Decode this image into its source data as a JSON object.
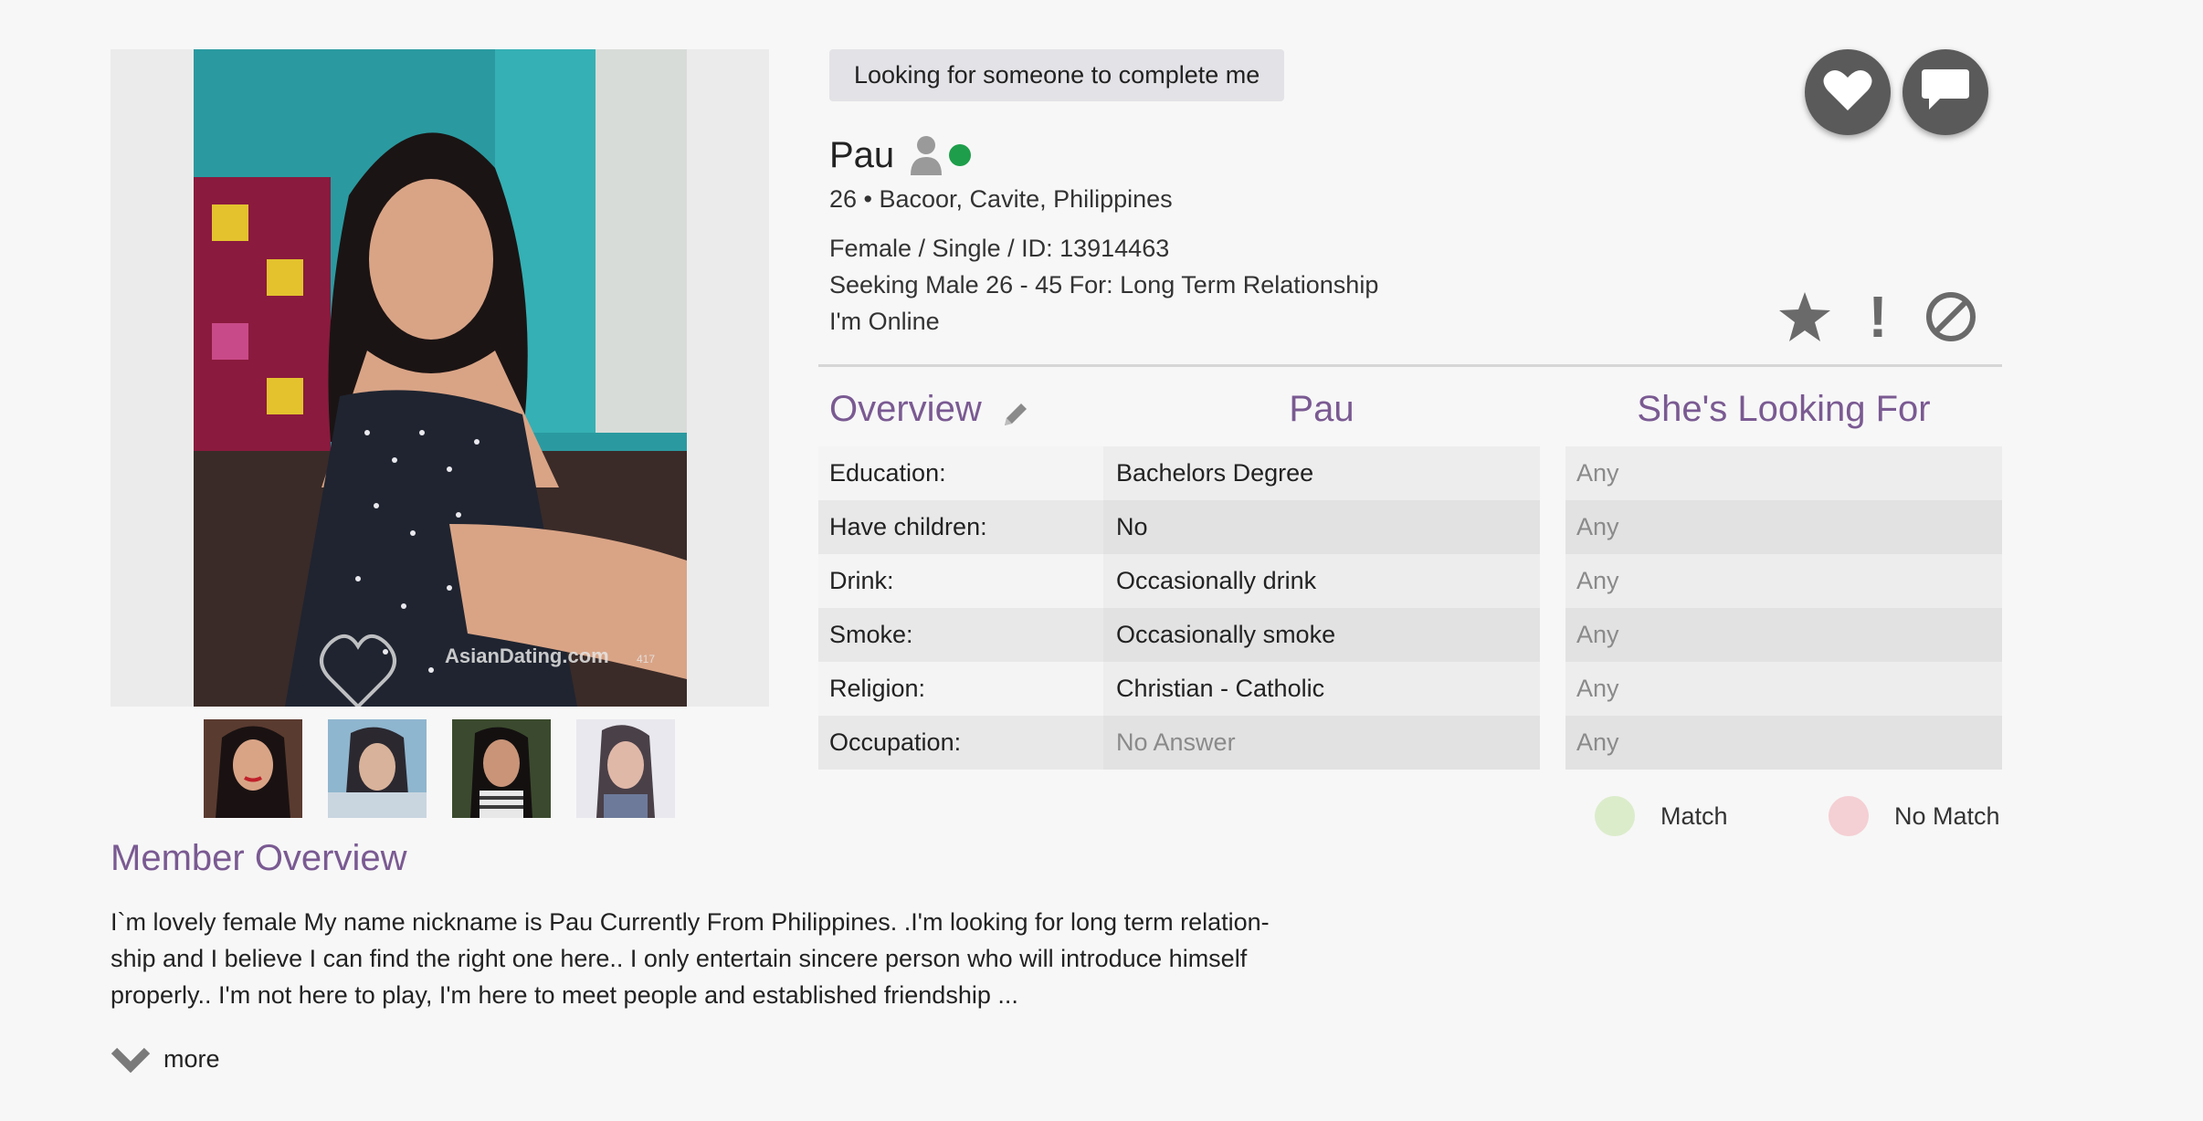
{
  "profile": {
    "headline": "Looking for someone to complete me",
    "name": "Pau",
    "age_location": "26 • Bacoor, Cavite, Philippines",
    "gender_status_id": "Female / Single / ID: 13914463",
    "seeking": "Seeking Male 26 - 45 For: Long Term Relationship",
    "online_status": "I'm Online"
  },
  "photo": {
    "watermark": "AsianDating.com",
    "watermark_small": "417",
    "thumbnail_count": 4
  },
  "icons": {
    "favorite": "heart-icon",
    "message": "chat-bubble-icon",
    "user": "user-icon",
    "online": "online-dot",
    "star": "star-icon",
    "report": "exclamation-icon",
    "block": "block-icon",
    "edit": "pencil-icon",
    "more": "chevron-down-icon"
  },
  "overview": {
    "title": "Overview",
    "pau_header": "Pau",
    "looking_header": "She's Looking For",
    "rows": [
      {
        "label": "Education:",
        "value": "Bachelors Degree",
        "looking": "Any"
      },
      {
        "label": "Have children:",
        "value": "No",
        "looking": "Any"
      },
      {
        "label": "Drink:",
        "value": "Occasionally drink",
        "looking": "Any"
      },
      {
        "label": "Smoke:",
        "value": "Occasionally smoke",
        "looking": "Any"
      },
      {
        "label": "Religion:",
        "value": "Christian - Catholic",
        "looking": "Any"
      },
      {
        "label": "Occupation:",
        "value": "No Answer",
        "looking": "Any"
      }
    ]
  },
  "legend": {
    "match": "Match",
    "no_match": "No Match"
  },
  "member_overview": {
    "title": "Member Overview",
    "text_line1": "I`m lovely female My name nickname is Pau Currently From Philippines. .I'm looking for long term relation-",
    "text_line2": "ship and I believe I can find the right one here.. I only entertain sincere person who will introduce himself",
    "text_line3": "properly.. I'm not here to play, I'm here to meet people and established friendship ...",
    "more_label": "more"
  },
  "colors": {
    "accent": "#7a5a92",
    "online": "#1e9e4a",
    "match": "#dbeccb",
    "no_match": "#f4cfd3",
    "button": "#5a5a5a"
  }
}
